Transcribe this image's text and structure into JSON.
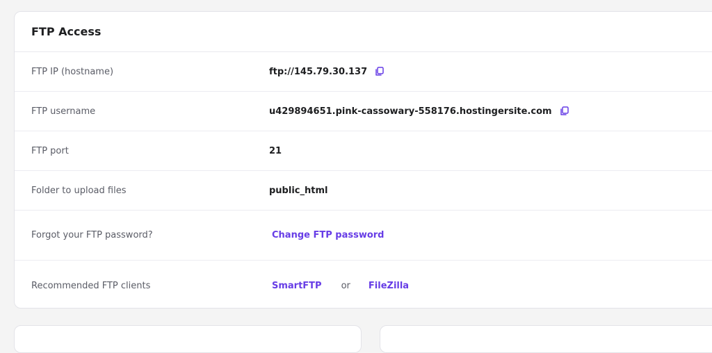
{
  "card": {
    "title": "FTP Access"
  },
  "rows": {
    "ip": {
      "label": "FTP IP (hostname)",
      "value": "ftp://145.79.30.137"
    },
    "username": {
      "label": "FTP username",
      "value": "u429894651.pink-cassowary-558176.hostingersite.com"
    },
    "port": {
      "label": "FTP port",
      "value": "21"
    },
    "folder": {
      "label": "Folder to upload files",
      "value": "public_html"
    },
    "password": {
      "label": "Forgot your FTP password?",
      "link": "Change FTP password"
    },
    "clients": {
      "label": "Recommended FTP clients",
      "client1": "SmartFTP",
      "separator": "or",
      "client2": "FileZilla"
    }
  },
  "icons": {
    "copy": "copy-icon"
  },
  "colors": {
    "accent": "#673de6",
    "title": "#1d1e20",
    "label": "#5a5c66"
  }
}
